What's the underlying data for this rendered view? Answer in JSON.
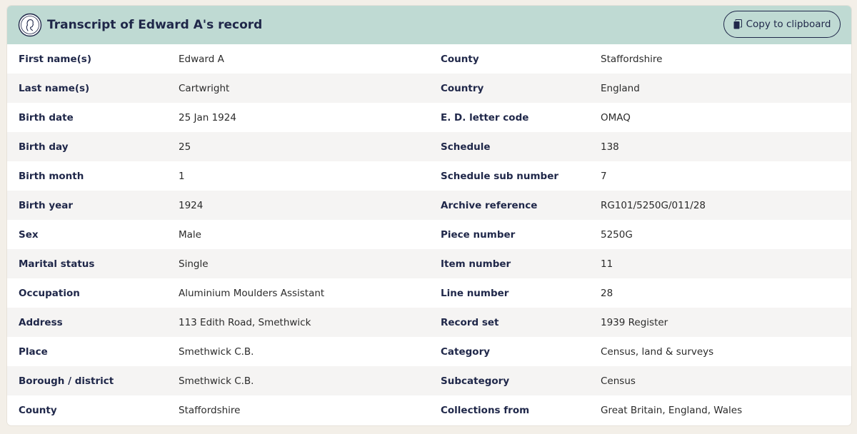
{
  "header": {
    "title": "Transcript of Edward A's record",
    "copy_label": "Copy to clipboard"
  },
  "records": [
    {
      "l1": "First name(s)",
      "v1": "Edward A",
      "l2": "County",
      "v2": "Staffordshire"
    },
    {
      "l1": "Last name(s)",
      "v1": "Cartwright",
      "l2": "Country",
      "v2": "England"
    },
    {
      "l1": "Birth date",
      "v1": "25 Jan 1924",
      "l2": "E. D. letter code",
      "v2": "OMAQ"
    },
    {
      "l1": "Birth day",
      "v1": "25",
      "l2": "Schedule",
      "v2": "138"
    },
    {
      "l1": "Birth month",
      "v1": "1",
      "l2": "Schedule sub number",
      "v2": "7"
    },
    {
      "l1": "Birth year",
      "v1": "1924",
      "l2": "Archive reference",
      "v2": "RG101/5250G/011/28"
    },
    {
      "l1": "Sex",
      "v1": "Male",
      "l2": "Piece number",
      "v2": "5250G"
    },
    {
      "l1": "Marital status",
      "v1": "Single",
      "l2": "Item number",
      "v2": "11"
    },
    {
      "l1": "Occupation",
      "v1": "Aluminium Moulders Assistant",
      "l2": "Line number",
      "v2": "28"
    },
    {
      "l1": "Address",
      "v1": "113 Edith Road, Smethwick",
      "l2": "Record set",
      "v2": "1939 Register"
    },
    {
      "l1": "Place",
      "v1": "Smethwick C.B.",
      "l2": "Category",
      "v2": "Census, land & surveys"
    },
    {
      "l1": "Borough / district",
      "v1": "Smethwick C.B.",
      "l2": "Subcategory",
      "v2": "Census"
    },
    {
      "l1": "County",
      "v1": "Staffordshire",
      "l2": "Collections from",
      "v2": "Great Britain, England, Wales"
    }
  ],
  "icons": {
    "logo": "person-silhouette-icon",
    "copy": "clipboard-icon"
  },
  "colors": {
    "header_bg": "#bfdad3",
    "text_dark": "#1f2749",
    "row_alt": "#f5f4f3",
    "page_bg": "#f3efe8"
  }
}
